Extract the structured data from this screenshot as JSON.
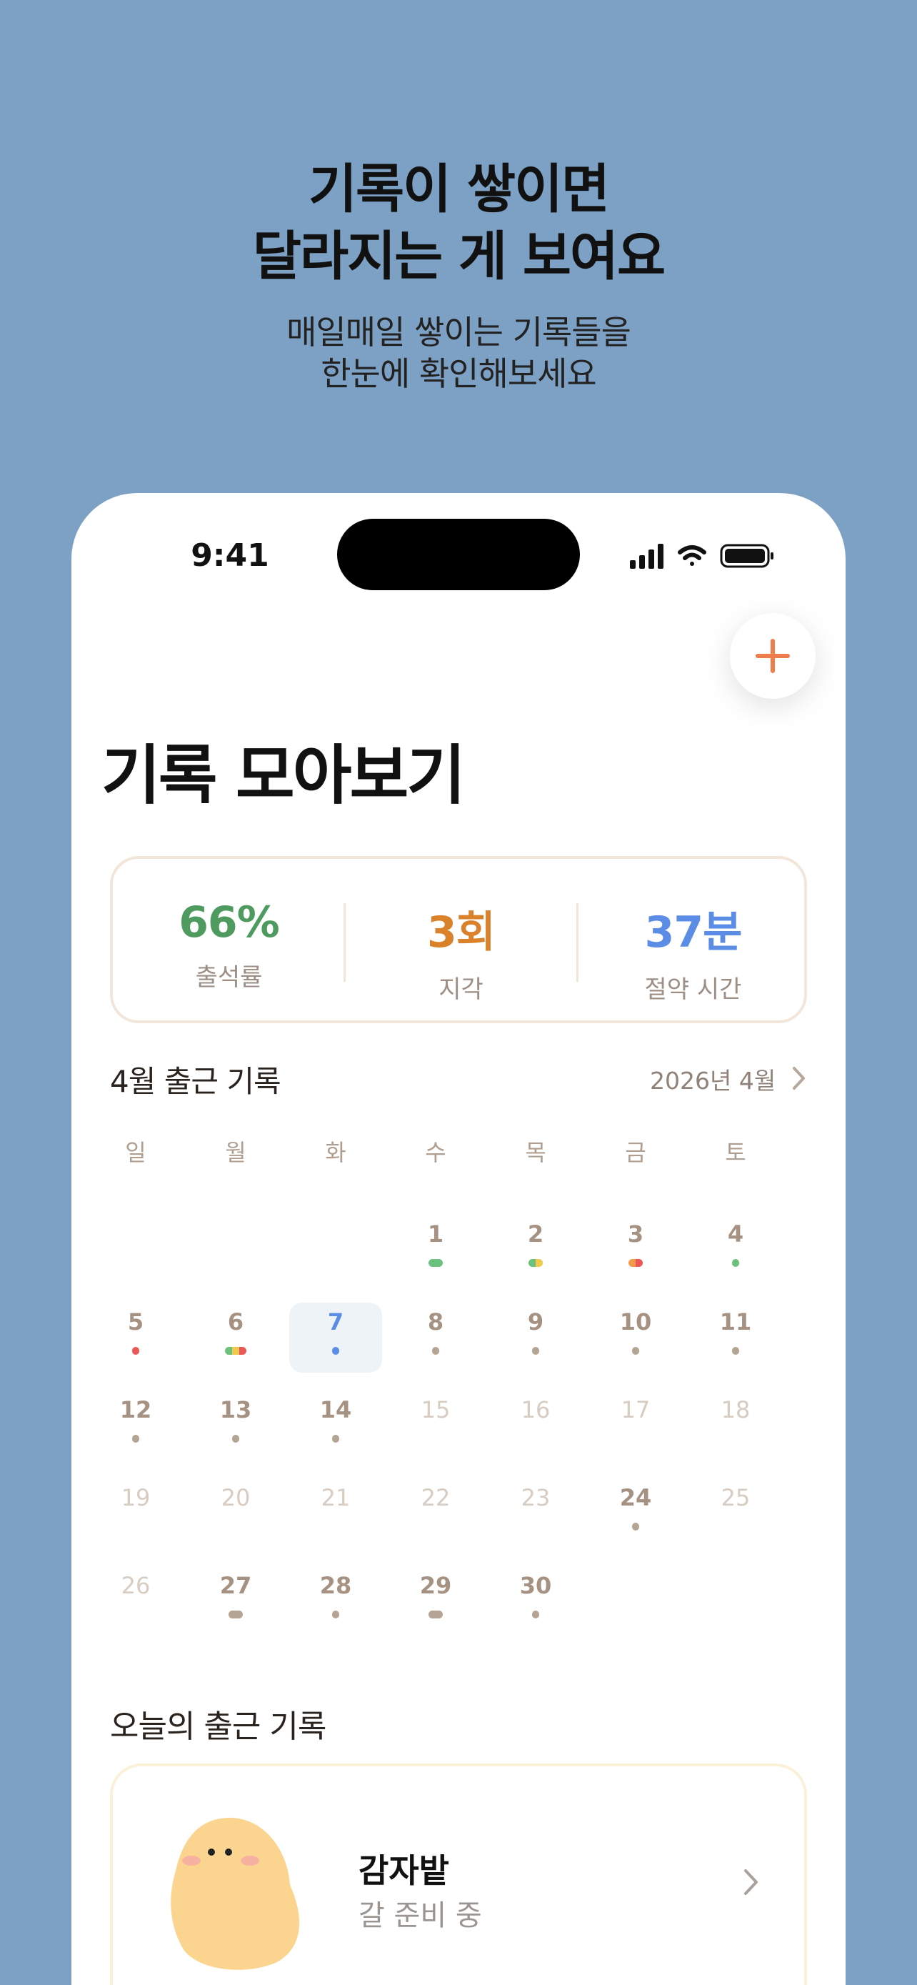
{
  "hero": {
    "title_line1": "기록이 쌓이면",
    "title_line2": "달라지는 게 보여요",
    "subtitle_line1": "매일매일 쌓이는 기록들을",
    "subtitle_line2": "한눈에 확인해보세요"
  },
  "status_bar": {
    "time": "9:41",
    "icons": [
      "signal-icon",
      "wifi-icon",
      "battery-icon"
    ]
  },
  "header": {
    "title": "기록 모아보기",
    "add_icon": "plus-icon"
  },
  "stats": [
    {
      "value": "66%",
      "label": "출석률",
      "color": "#4e9a5f"
    },
    {
      "value": "3회",
      "label": "지각",
      "color": "#d9822b"
    },
    {
      "value": "37분",
      "label": "절약 시간",
      "color": "#5b8de6"
    }
  ],
  "calendar": {
    "title": "4월 출근 기록",
    "month_label": "2026년 4월",
    "weekdays": [
      "일",
      "월",
      "화",
      "수",
      "목",
      "금",
      "토"
    ],
    "colors": {
      "green": "#6cc17f",
      "yellow": "#f2c94c",
      "red": "#eb5757",
      "orange": "#f2994a",
      "blue": "#5b8de6",
      "gray": "#b5a393"
    },
    "today": "7"
  },
  "today_section": {
    "title": "오늘의 출근 기록",
    "name": "감자밭",
    "status": "갈 준비 중"
  }
}
